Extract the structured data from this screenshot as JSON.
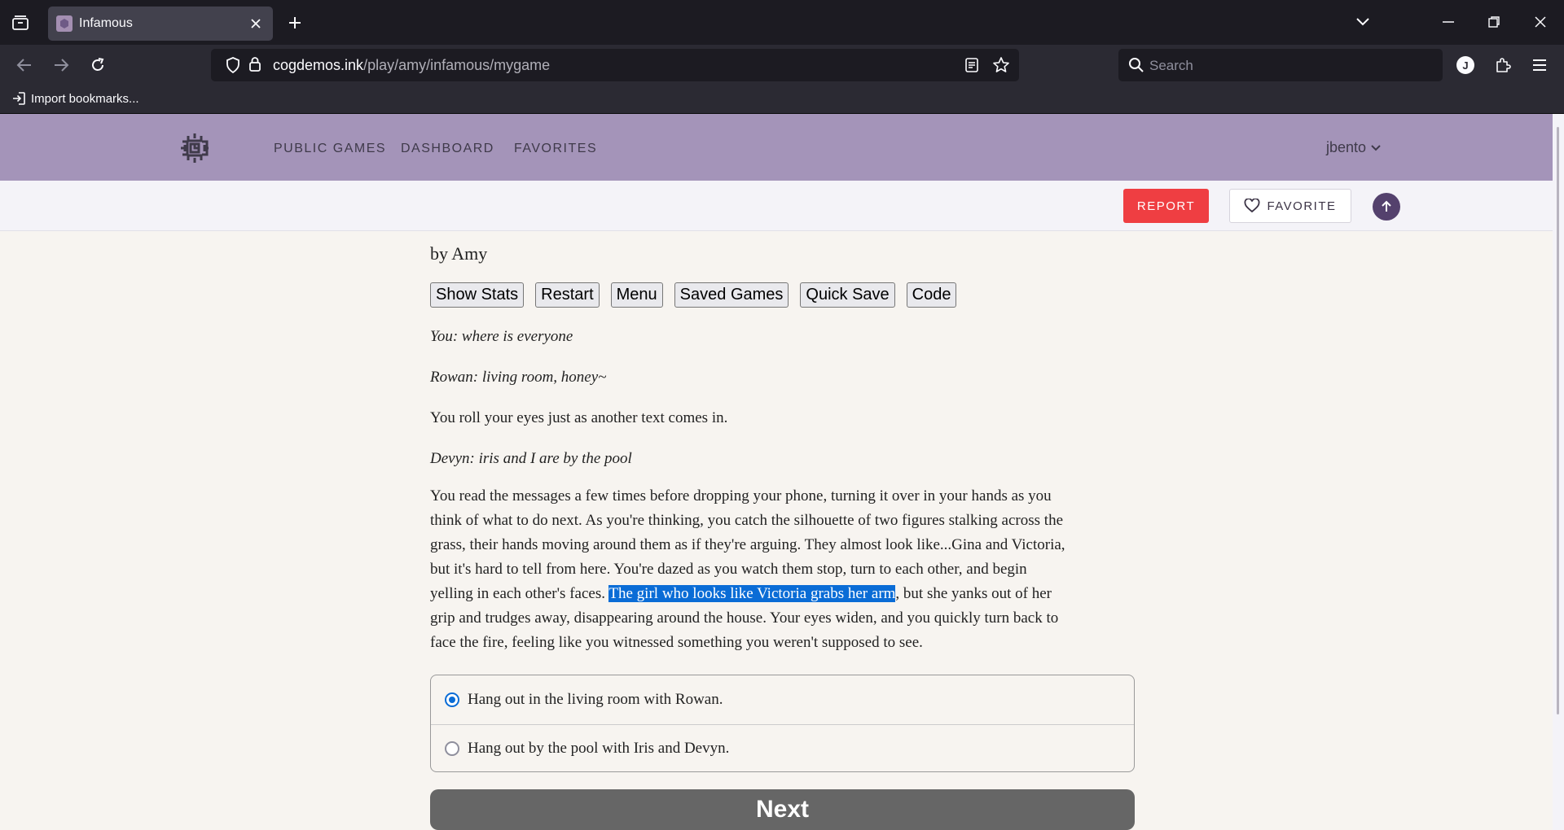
{
  "browser": {
    "tab_title": "Infamous",
    "url_host": "cogdemos.ink",
    "url_path": "/play/amy/infamous/mygame",
    "search_placeholder": "Search",
    "bookmarks_item": "Import bookmarks...",
    "profile_initial": "J"
  },
  "site": {
    "nav": [
      "PUBLIC GAMES",
      "DASHBOARD",
      "FAVORITES"
    ],
    "username": "jbento",
    "report_label": "REPORT",
    "favorite_label": "FAVORITE",
    "accent": "#a494b9",
    "report_color": "#ef3e42"
  },
  "game": {
    "byline": "by Amy",
    "buttons": [
      "Show Stats",
      "Restart",
      "Menu",
      "Saved Games",
      "Quick Save",
      "Code"
    ],
    "lines": [
      "You: where is everyone",
      "Rowan: living room, honey~",
      "You roll your eyes just as another text comes in.",
      "Devyn: iris and I are by the pool"
    ],
    "paragraph": {
      "l1": "You read the messages a few times before dropping your phone, turning it over in your hands as you",
      "l2": "think of what to do next. As you're thinking, you catch the silhouette of two figures stalking across the",
      "l3": "grass, their hands moving around them as if they're arguing. They almost look like...Gina and Victoria,",
      "l4": "but it's hard to tell from here. You're dazed as you watch them stop, turn to each other, and begin",
      "l5_pre": "yelling in each other's faces. ",
      "l5_highlight": "The girl who looks like Victoria grabs her arm",
      "l5_post": ", but she yanks out of her",
      "l6": "grip and trudges away, disappearing around the house. Your eyes widen, and you quickly turn back to",
      "l7": "face the fire, feeling like you witnessed something you weren't supposed to see."
    },
    "choices": [
      "Hang out in the living room with Rowan.",
      "Hang out by the pool with Iris and Devyn."
    ],
    "selected_choice": 0,
    "next_label": "Next"
  }
}
